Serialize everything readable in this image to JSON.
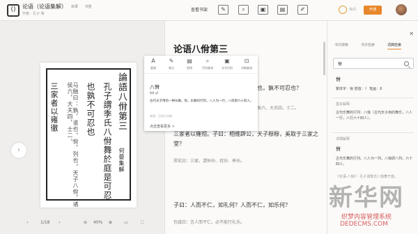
{
  "topbar": {
    "logo": "()",
    "doc_title": "论语（论语集解）",
    "doc_sub": "作者：孔子 等",
    "menu": [
      "目录",
      "书签"
    ],
    "center_label": "查看书架",
    "tools": [
      "✎",
      "⌕",
      "▣",
      "▤",
      "✐"
    ],
    "theme_label": "夜间",
    "vip_label": "开通"
  },
  "viewer": {
    "scan_columns": [
      "論語八佾第三",
      "何晏集解",
      "孔子謂季氏八佾舞於庭是可忍",
      "也孰不可忍也",
      "三家者以雍徹"
    ],
    "page_indicator": "1/18",
    "zoom": "40%"
  },
  "reading": {
    "chapter_title": "论语八佾第三",
    "paragraphs": [
      "孔子谓季氏：八佾舞于庭，是可忍也，孰不可忍也？",
      "三家者以雍彻。子曰：相维辟公，天子穆穆，奚取于三家之堂？",
      "子曰：人而不仁，如礼何？人而不仁，如乐何？"
    ],
    "notes": [
      "马融曰：孰，谁也。佾，列也。天子八佾，诸侯六，大夫四，士二。",
      "郑玄曰：三家，谓仲孙、叔孙、季孙。",
      "包咸曰：言人而不仁，必不能行礼乐。"
    ]
  },
  "popup": {
    "tools": [
      {
        "icon": "A",
        "label": "复制"
      },
      {
        "icon": "✎",
        "label": "笔记"
      },
      {
        "icon": "▤",
        "label": "划线"
      },
      {
        "icon": "⌕",
        "label": "百科查询"
      },
      {
        "icon": "▣",
        "label": "文字识别"
      },
      {
        "icon": "⊡",
        "label": "词典查询"
      }
    ],
    "word": "八佾",
    "pinyin": "bā yì",
    "definition": "古代天子用的一种乐舞。佾，乐舞的行列，八人为一行，八佾即六十四人。",
    "source": "来源：汉语大词典",
    "more": "点击查看更多 >"
  },
  "rpanel": {
    "tabs": [
      "书内搜索",
      "书外检索",
      "词典检索"
    ],
    "active_tab": 2,
    "search_value": "佾",
    "entries": [
      {
        "text": "佾",
        "style": "head"
      },
      {
        "text": "繁体字：佾   部首：亻   笔画：8",
        "style": "normal"
      },
      {
        "text": "基本解释",
        "style": "grey"
      },
      {
        "text": "古代乐舞的行列：八佾（古代天子用的舞乐，八人一行，八行六十四人）。",
        "style": "normal"
      },
      {
        "text": "详细解释",
        "style": "grey"
      },
      {
        "text": "佾",
        "style": "head"
      },
      {
        "text": "古代乐舞的行列。八人为一列，八佾即八列，六十四人。",
        "style": "normal"
      },
      {
        "text": "《论语·八佾》：孔子谓季氏八佾舞于庭。",
        "style": "grey"
      }
    ]
  },
  "watermark": {
    "big": "新华网",
    "line1": "织梦内容管理系统",
    "line2": "DEDECMS.COM"
  }
}
